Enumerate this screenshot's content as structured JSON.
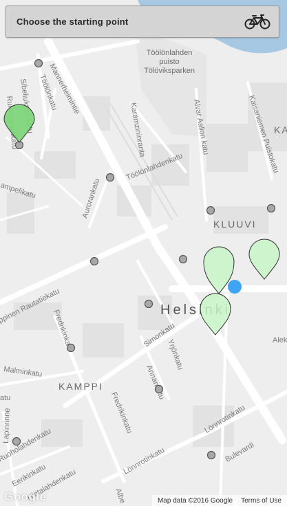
{
  "header": {
    "title": "Choose the starting point",
    "icon": "bicycle-icon"
  },
  "map": {
    "city_label": "Helsinki",
    "districts": [
      "KLUUVI",
      "KAMPPI",
      "KA"
    ],
    "park_labels": [
      "Töölönlahden",
      "puisto",
      "Tölöviksparken"
    ],
    "streets": [
      "Mannerheimintie",
      "Töölönkatu",
      "Karamzininranta",
      "Alvar Aallon katu",
      "Kaisaniemen Puistokatu",
      "Töölönlahdenkatu",
      "Aurorankatu",
      "ampelikatu",
      "ppinen Rautatiekatu",
      "Fredrikinkatu",
      "Simonkatu",
      "Yrjönkatu",
      "Malminkatu",
      "Annankatu",
      "Fredrikinkatu",
      "Lönnrotinkatu",
      "Bulevardi",
      "Lönnrotinkatu",
      "Ruoholahdenkatu",
      "Eerikinkatu",
      "Lapinrinne",
      "Hietalahdenkatu",
      "atu",
      "Albe",
      "Alek",
      "Sibeliuksen katu",
      "Runeberginkatu"
    ],
    "colors": {
      "pin_selected": "#7ed67a",
      "pin_available": "#c8f5c8",
      "station_fill": "#a8a8a8",
      "user_location": "#3fa4f2",
      "water": "#a7c8e2"
    },
    "user_location_icon": "user-location-dot"
  },
  "attribution": {
    "logo": "Google",
    "map_data": "Map data ©2016 Google",
    "terms": "Terms of Use"
  }
}
